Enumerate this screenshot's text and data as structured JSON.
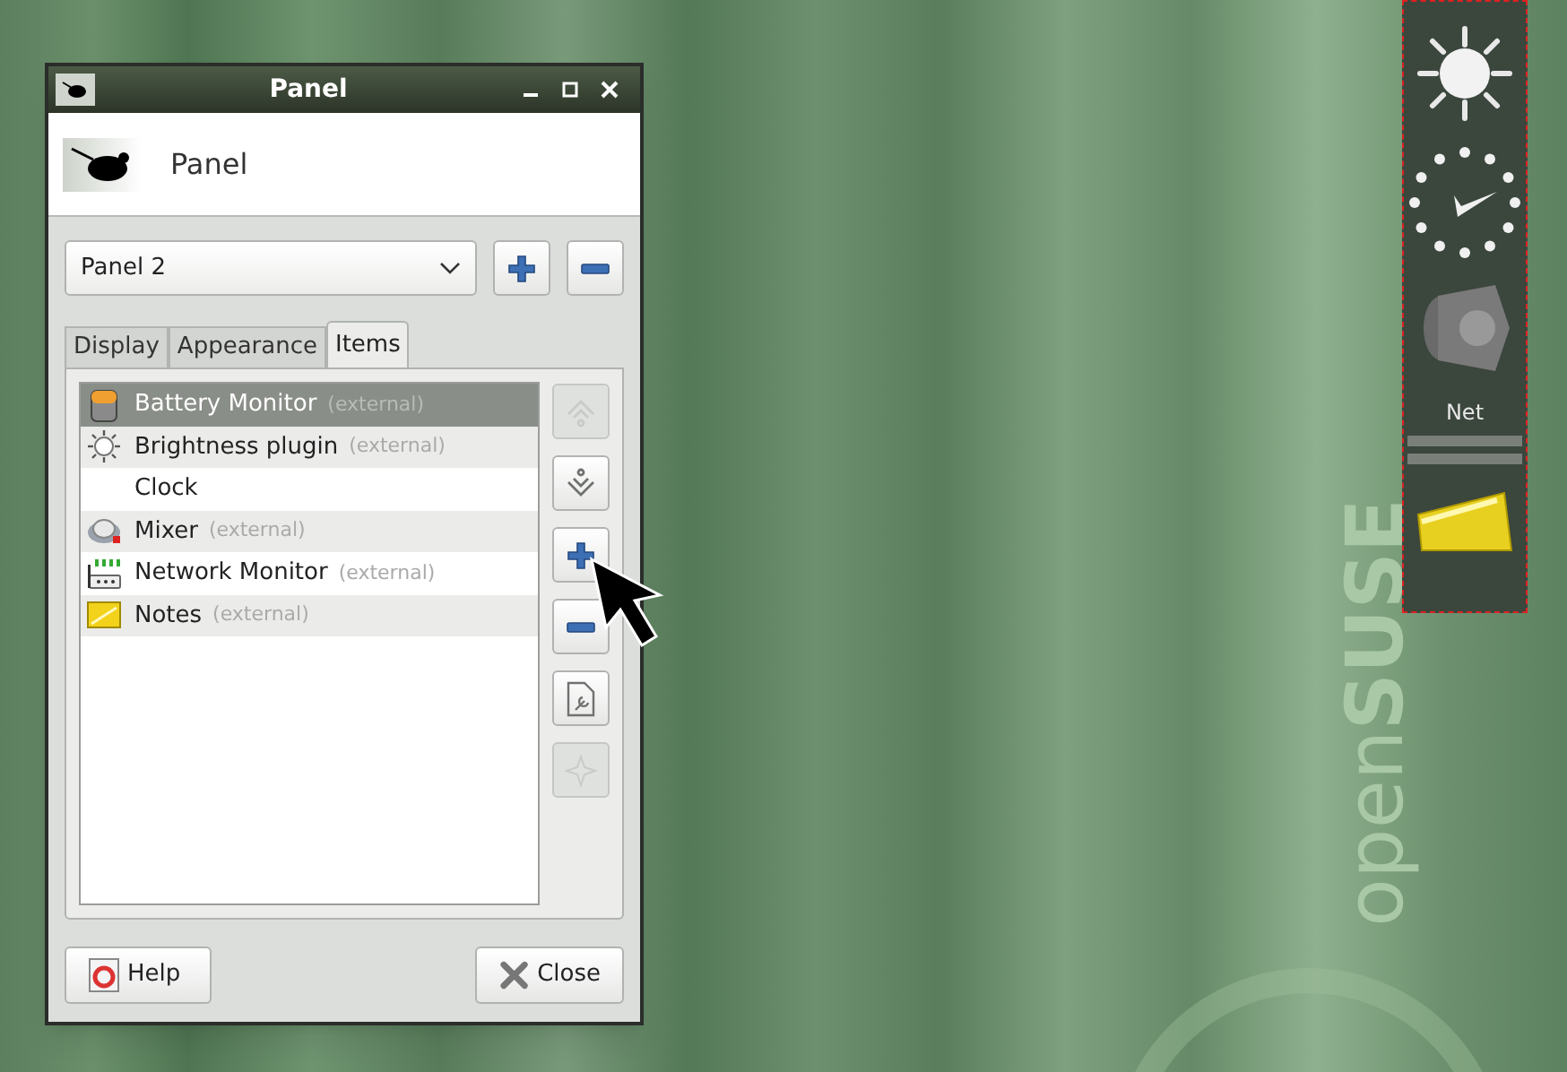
{
  "window": {
    "title": "Panel"
  },
  "header": {
    "title": "Panel"
  },
  "panel_select": {
    "value": "Panel 2"
  },
  "tabs": [
    {
      "label": "Display",
      "selected": false
    },
    {
      "label": "Appearance",
      "selected": false
    },
    {
      "label": "Items",
      "selected": true
    }
  ],
  "items": [
    {
      "name": "Battery Monitor",
      "note": "(external)",
      "kind": "battery",
      "selected": true
    },
    {
      "name": "Brightness plugin",
      "note": "(external)",
      "kind": "brightness",
      "selected": false
    },
    {
      "name": "Clock",
      "kind": "none",
      "selected": false
    },
    {
      "name": "Mixer",
      "note": "(external)",
      "kind": "mixer",
      "selected": false
    },
    {
      "name": "Network Monitor",
      "note": "(external)",
      "kind": "network",
      "selected": false
    },
    {
      "name": "Notes",
      "note": "(external)",
      "kind": "notes",
      "selected": false
    }
  ],
  "item_actions": [
    {
      "kind": "up",
      "disabled": true
    },
    {
      "kind": "down",
      "disabled": false
    },
    {
      "kind": "add",
      "disabled": false
    },
    {
      "kind": "remove",
      "disabled": false
    },
    {
      "kind": "edit",
      "disabled": false
    },
    {
      "kind": "about",
      "disabled": true
    }
  ],
  "buttons": [
    {
      "label": "Help",
      "kind": "help"
    },
    {
      "label": "Close",
      "kind": "close"
    }
  ],
  "desktop_panel": {
    "net_label": "Net"
  },
  "wallpaper": {
    "logo": "open**SUSE**"
  }
}
